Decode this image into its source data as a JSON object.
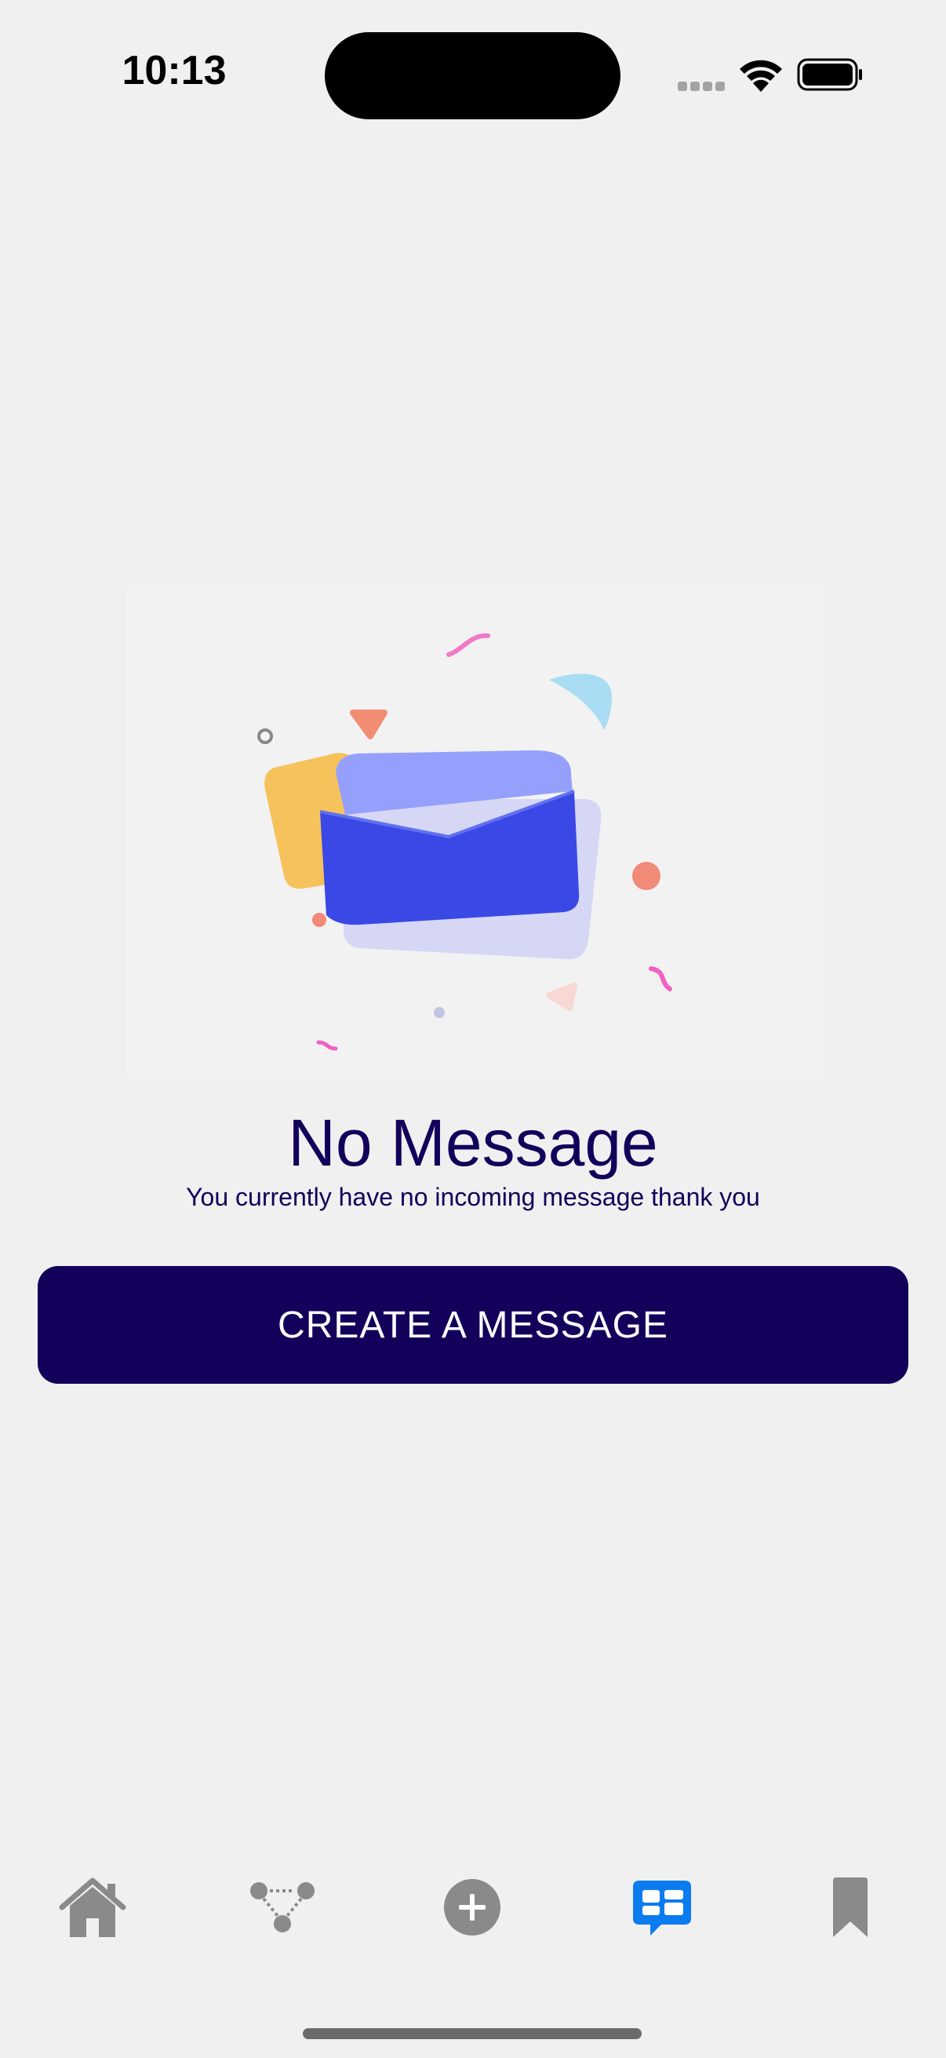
{
  "status_bar": {
    "time": "10:13"
  },
  "empty_state": {
    "illustration_icon": "envelope-illustration",
    "title": "No Message",
    "subtitle": "You currently have no incoming message thank you"
  },
  "actions": {
    "create_label": "CREATE A MESSAGE"
  },
  "tab_bar": {
    "items": [
      {
        "icon": "home-icon",
        "active": false
      },
      {
        "icon": "network-icon",
        "active": false
      },
      {
        "icon": "add-circle-icon",
        "active": false
      },
      {
        "icon": "messages-icon",
        "active": true
      },
      {
        "icon": "bookmark-icon",
        "active": false
      }
    ]
  },
  "colors": {
    "background": "#f0f0f0",
    "primary": "#13005a",
    "active_tab": "#0a7cf0",
    "inactive_tab": "#8a8a8a"
  }
}
